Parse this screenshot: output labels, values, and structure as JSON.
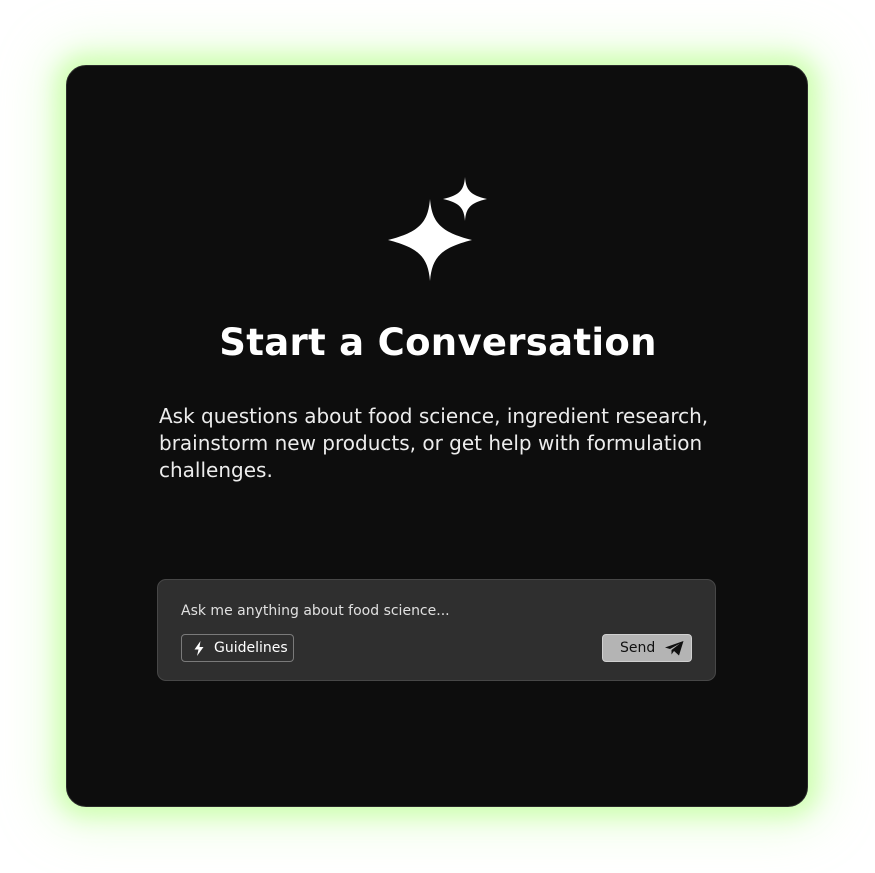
{
  "hero": {
    "icon": "sparkles-icon",
    "title": "Start a Conversation",
    "subtitle": "Ask questions about food science, ingredient research, brainstorm new products, or get help with formulation challenges."
  },
  "composer": {
    "placeholder": "Ask me anything about food science...",
    "value": "",
    "guidelines_label": "Guidelines",
    "guidelines_icon": "lightning-icon",
    "send_label": "Send",
    "send_icon": "paper-plane-icon"
  },
  "colors": {
    "card_background": "#0d0d0d",
    "glow": "#bfff96",
    "composer_background": "#2f2f2f",
    "send_background": "#b4b4b4"
  }
}
